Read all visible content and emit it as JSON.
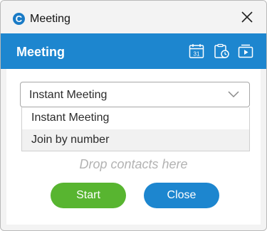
{
  "window": {
    "title": "Meeting",
    "app_icon_glyph": "C"
  },
  "header": {
    "title": "Meeting",
    "icons": [
      "calendar-icon",
      "schedule-clipboard-icon",
      "media-player-icon"
    ],
    "calendar_day": "31"
  },
  "meeting_type": {
    "selected": "Instant Meeting",
    "options": [
      "Instant Meeting",
      "Join by number"
    ],
    "highlighted_option": "Join by number"
  },
  "drop_hint": "Drop contacts here",
  "buttons": {
    "start_label": "Start",
    "close_label": "Close"
  },
  "colors": {
    "accent_blue": "#1d86cf",
    "start_green": "#58b530"
  }
}
